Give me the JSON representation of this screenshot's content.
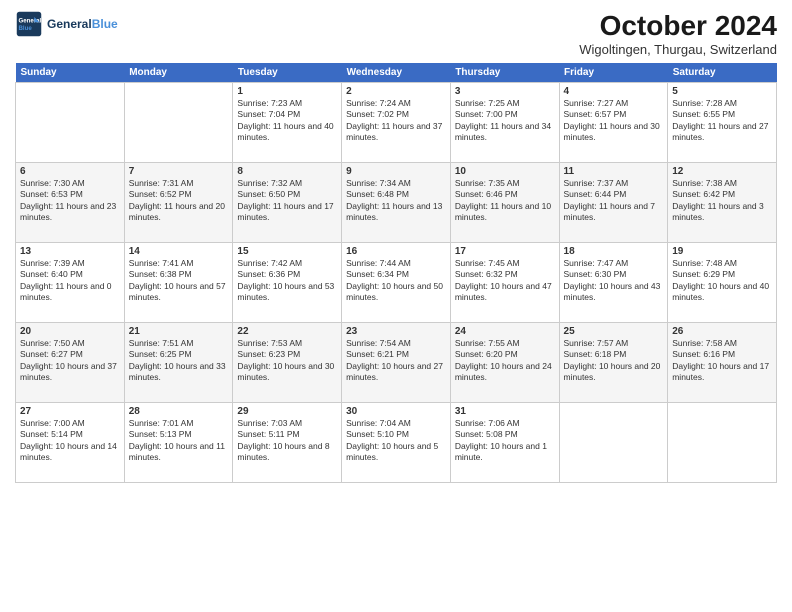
{
  "logo": {
    "line1": "General",
    "line2": "Blue"
  },
  "title": "October 2024",
  "subtitle": "Wigoltingen, Thurgau, Switzerland",
  "days_of_week": [
    "Sunday",
    "Monday",
    "Tuesday",
    "Wednesday",
    "Thursday",
    "Friday",
    "Saturday"
  ],
  "weeks": [
    [
      {
        "day": "",
        "info": ""
      },
      {
        "day": "",
        "info": ""
      },
      {
        "day": "1",
        "info": "Sunrise: 7:23 AM\nSunset: 7:04 PM\nDaylight: 11 hours and 40 minutes."
      },
      {
        "day": "2",
        "info": "Sunrise: 7:24 AM\nSunset: 7:02 PM\nDaylight: 11 hours and 37 minutes."
      },
      {
        "day": "3",
        "info": "Sunrise: 7:25 AM\nSunset: 7:00 PM\nDaylight: 11 hours and 34 minutes."
      },
      {
        "day": "4",
        "info": "Sunrise: 7:27 AM\nSunset: 6:57 PM\nDaylight: 11 hours and 30 minutes."
      },
      {
        "day": "5",
        "info": "Sunrise: 7:28 AM\nSunset: 6:55 PM\nDaylight: 11 hours and 27 minutes."
      }
    ],
    [
      {
        "day": "6",
        "info": "Sunrise: 7:30 AM\nSunset: 6:53 PM\nDaylight: 11 hours and 23 minutes."
      },
      {
        "day": "7",
        "info": "Sunrise: 7:31 AM\nSunset: 6:52 PM\nDaylight: 11 hours and 20 minutes."
      },
      {
        "day": "8",
        "info": "Sunrise: 7:32 AM\nSunset: 6:50 PM\nDaylight: 11 hours and 17 minutes."
      },
      {
        "day": "9",
        "info": "Sunrise: 7:34 AM\nSunset: 6:48 PM\nDaylight: 11 hours and 13 minutes."
      },
      {
        "day": "10",
        "info": "Sunrise: 7:35 AM\nSunset: 6:46 PM\nDaylight: 11 hours and 10 minutes."
      },
      {
        "day": "11",
        "info": "Sunrise: 7:37 AM\nSunset: 6:44 PM\nDaylight: 11 hours and 7 minutes."
      },
      {
        "day": "12",
        "info": "Sunrise: 7:38 AM\nSunset: 6:42 PM\nDaylight: 11 hours and 3 minutes."
      }
    ],
    [
      {
        "day": "13",
        "info": "Sunrise: 7:39 AM\nSunset: 6:40 PM\nDaylight: 11 hours and 0 minutes."
      },
      {
        "day": "14",
        "info": "Sunrise: 7:41 AM\nSunset: 6:38 PM\nDaylight: 10 hours and 57 minutes."
      },
      {
        "day": "15",
        "info": "Sunrise: 7:42 AM\nSunset: 6:36 PM\nDaylight: 10 hours and 53 minutes."
      },
      {
        "day": "16",
        "info": "Sunrise: 7:44 AM\nSunset: 6:34 PM\nDaylight: 10 hours and 50 minutes."
      },
      {
        "day": "17",
        "info": "Sunrise: 7:45 AM\nSunset: 6:32 PM\nDaylight: 10 hours and 47 minutes."
      },
      {
        "day": "18",
        "info": "Sunrise: 7:47 AM\nSunset: 6:30 PM\nDaylight: 10 hours and 43 minutes."
      },
      {
        "day": "19",
        "info": "Sunrise: 7:48 AM\nSunset: 6:29 PM\nDaylight: 10 hours and 40 minutes."
      }
    ],
    [
      {
        "day": "20",
        "info": "Sunrise: 7:50 AM\nSunset: 6:27 PM\nDaylight: 10 hours and 37 minutes."
      },
      {
        "day": "21",
        "info": "Sunrise: 7:51 AM\nSunset: 6:25 PM\nDaylight: 10 hours and 33 minutes."
      },
      {
        "day": "22",
        "info": "Sunrise: 7:53 AM\nSunset: 6:23 PM\nDaylight: 10 hours and 30 minutes."
      },
      {
        "day": "23",
        "info": "Sunrise: 7:54 AM\nSunset: 6:21 PM\nDaylight: 10 hours and 27 minutes."
      },
      {
        "day": "24",
        "info": "Sunrise: 7:55 AM\nSunset: 6:20 PM\nDaylight: 10 hours and 24 minutes."
      },
      {
        "day": "25",
        "info": "Sunrise: 7:57 AM\nSunset: 6:18 PM\nDaylight: 10 hours and 20 minutes."
      },
      {
        "day": "26",
        "info": "Sunrise: 7:58 AM\nSunset: 6:16 PM\nDaylight: 10 hours and 17 minutes."
      }
    ],
    [
      {
        "day": "27",
        "info": "Sunrise: 7:00 AM\nSunset: 5:14 PM\nDaylight: 10 hours and 14 minutes."
      },
      {
        "day": "28",
        "info": "Sunrise: 7:01 AM\nSunset: 5:13 PM\nDaylight: 10 hours and 11 minutes."
      },
      {
        "day": "29",
        "info": "Sunrise: 7:03 AM\nSunset: 5:11 PM\nDaylight: 10 hours and 8 minutes."
      },
      {
        "day": "30",
        "info": "Sunrise: 7:04 AM\nSunset: 5:10 PM\nDaylight: 10 hours and 5 minutes."
      },
      {
        "day": "31",
        "info": "Sunrise: 7:06 AM\nSunset: 5:08 PM\nDaylight: 10 hours and 1 minute."
      },
      {
        "day": "",
        "info": ""
      },
      {
        "day": "",
        "info": ""
      }
    ]
  ]
}
